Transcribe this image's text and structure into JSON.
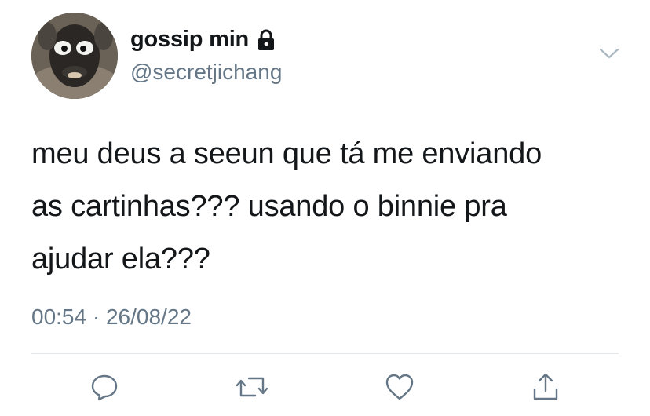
{
  "tweet": {
    "author": {
      "display_name": "gossip min",
      "handle": "@secretjichang",
      "protected": true,
      "avatar_icon": "sheep-face-avatar"
    },
    "text_lines": [
      "meu deus a seeun que tá me enviando",
      "as cartinhas??? usando o binnie pra",
      "ajudar ela???"
    ],
    "time": "00:54",
    "separator": "·",
    "date": "26/08/22"
  },
  "actions": [
    {
      "icon": "reply-icon"
    },
    {
      "icon": "retweet-icon"
    },
    {
      "icon": "like-icon"
    },
    {
      "icon": "share-icon"
    }
  ],
  "colors": {
    "text": "#14171a",
    "secondary": "#657786",
    "divider": "#e1e8ed",
    "icon": "#657786"
  }
}
